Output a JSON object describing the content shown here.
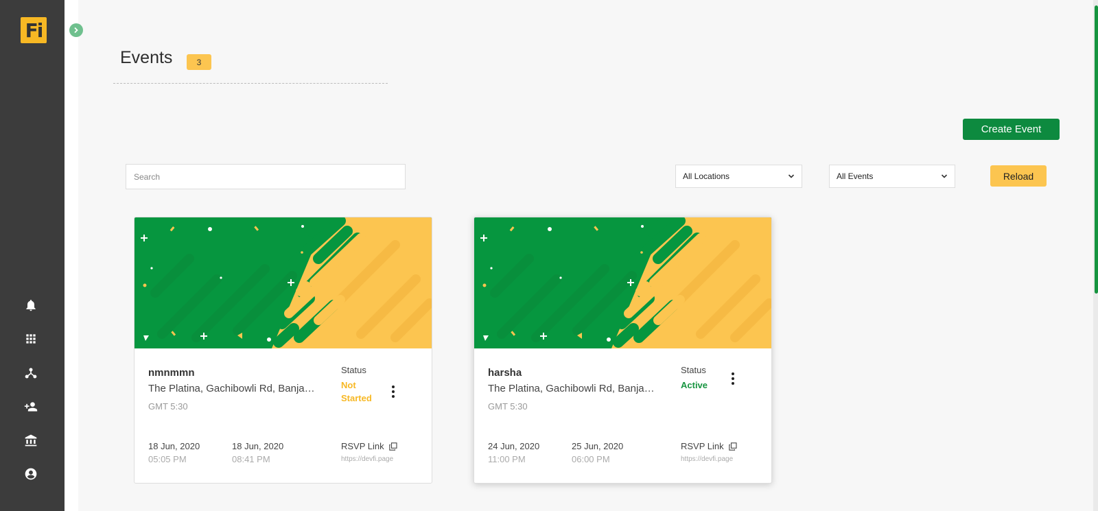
{
  "app": {
    "logo_text": "Fi"
  },
  "sidebar": {
    "items": [
      {
        "name": "notifications",
        "icon": "bell-icon"
      },
      {
        "name": "apps",
        "icon": "grid-icon"
      },
      {
        "name": "network",
        "icon": "hierarchy-icon"
      },
      {
        "name": "add-user",
        "icon": "person-add-icon"
      },
      {
        "name": "institution",
        "icon": "bank-icon"
      },
      {
        "name": "account",
        "icon": "user-circle-icon"
      }
    ]
  },
  "header": {
    "title": "Events",
    "count": "3"
  },
  "toolbar": {
    "create_label": "Create Event",
    "search_placeholder": "Search",
    "location_filter": "All Locations",
    "event_filter": "All Events",
    "reload_label": "Reload"
  },
  "events": [
    {
      "name": "nmnmmn",
      "location": "The Platina, Gachibowli Rd, Banjara Hills",
      "timezone": "GMT 5:30",
      "status_label": "Status",
      "status": "Not Started",
      "status_color": "#f7b824",
      "start_date": "18 Jun, 2020",
      "start_time": "05:05 PM",
      "end_date": "18 Jun, 2020",
      "end_time": "08:41 PM",
      "rsvp_label": "RSVP Link",
      "rsvp_url": "https://devfi.page"
    },
    {
      "name": "harsha",
      "location": "The Platina, Gachibowli Rd, Banjara Hills",
      "timezone": "GMT 5:30",
      "status_label": "Status",
      "status": "Active",
      "status_color": "#16943f",
      "start_date": "24 Jun, 2020",
      "start_time": "11:00 PM",
      "end_date": "25 Jun, 2020",
      "end_time": "06:00 PM",
      "rsvp_label": "RSVP Link",
      "rsvp_url": "https://devfi.page"
    }
  ],
  "colors": {
    "brand_green": "#0d8a3f",
    "brand_yellow": "#fcc550",
    "sidebar": "#3c3c3c"
  }
}
